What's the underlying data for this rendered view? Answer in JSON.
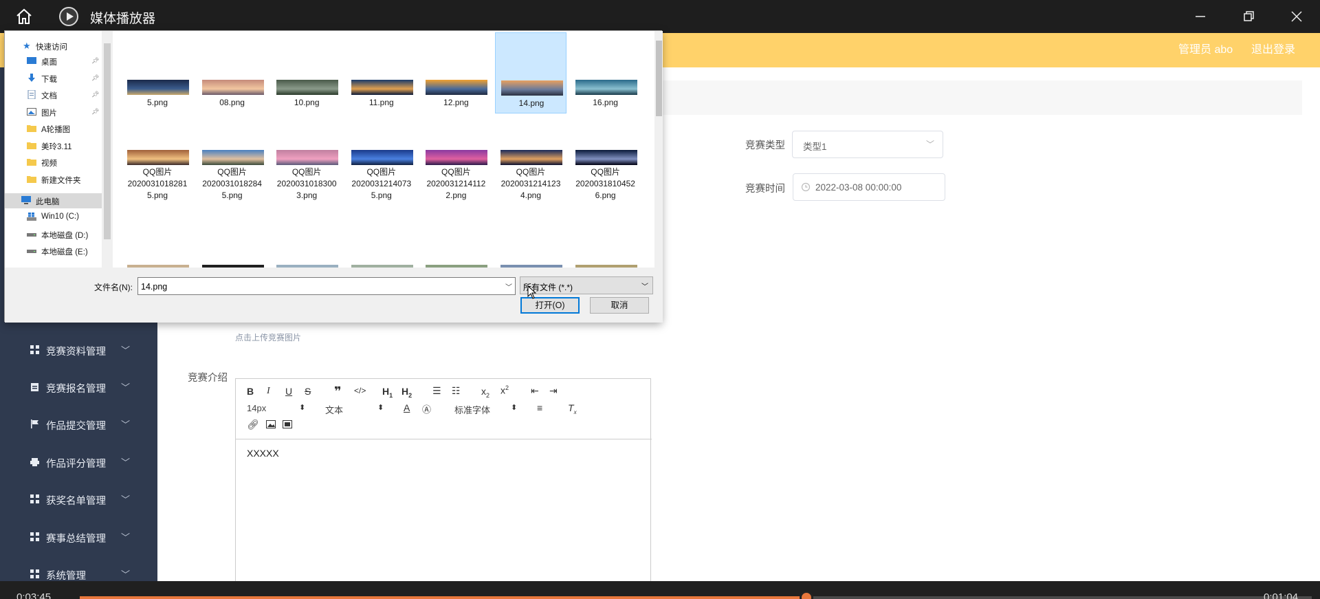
{
  "titlebar": {
    "title": "媒体播放器"
  },
  "header": {
    "admin": "管理员 abo",
    "logout": "退出登录"
  },
  "sidebar": {
    "items": [
      {
        "label": "竞赛资料管理",
        "icon": "grid-icon"
      },
      {
        "label": "竞赛报名管理",
        "icon": "clipboard-icon"
      },
      {
        "label": "作品提交管理",
        "icon": "flag-icon"
      },
      {
        "label": "作品评分管理",
        "icon": "printer-icon"
      },
      {
        "label": "获奖名单管理",
        "icon": "grid-icon"
      },
      {
        "label": "赛事总结管理",
        "icon": "grid-icon"
      },
      {
        "label": "系统管理",
        "icon": "grid-icon"
      }
    ]
  },
  "form": {
    "type_label": "竞赛类型",
    "type_value": "类型1",
    "time_label": "竞赛时间",
    "time_value": "2022-03-08 00:00:00",
    "upload_hint": "点击上传竞赛图片",
    "intro_label": "竞赛介绍",
    "editor": {
      "font_size": "14px",
      "text_style": "文本",
      "font_family": "标准字体",
      "content": "XXXXX"
    }
  },
  "player": {
    "elapsed": "0:03:45",
    "remaining": "0:01:04",
    "progress": 0.59
  },
  "dialog": {
    "nav": {
      "quick_access": "快速访问",
      "items": [
        {
          "label": "桌面",
          "icon": "desktop-icon",
          "pinned": true
        },
        {
          "label": "下载",
          "icon": "download-icon",
          "pinned": true
        },
        {
          "label": "文档",
          "icon": "document-icon",
          "pinned": true
        },
        {
          "label": "图片",
          "icon": "picture-icon",
          "pinned": true
        },
        {
          "label": "A轮播图",
          "icon": "folder-icon",
          "pinned": false
        },
        {
          "label": "美玲3.11",
          "icon": "folder-icon",
          "pinned": false
        },
        {
          "label": "视频",
          "icon": "folder-icon",
          "pinned": false
        },
        {
          "label": "新建文件夹",
          "icon": "folder-icon",
          "pinned": false
        }
      ],
      "this_pc": "此电脑",
      "drives": [
        {
          "label": "Win10 (C:)",
          "icon": "windows-drive-icon"
        },
        {
          "label": "本地磁盘 (D:)",
          "icon": "drive-icon"
        },
        {
          "label": "本地磁盘 (E:)",
          "icon": "drive-icon"
        }
      ]
    },
    "files": [
      {
        "lines": [
          "5.png"
        ],
        "colors": [
          "#1b2a4a",
          "#3b5c8c",
          "#c9a86a"
        ]
      },
      {
        "lines": [
          "08.png"
        ],
        "colors": [
          "#c58a7a",
          "#f2c6a0",
          "#6a5a6a"
        ]
      },
      {
        "lines": [
          "10.png"
        ],
        "colors": [
          "#4a5a4a",
          "#8a9a8a",
          "#2a3a2a"
        ]
      },
      {
        "lines": [
          "11.png"
        ],
        "colors": [
          "#1a3a6a",
          "#e0a050",
          "#0a1a3a"
        ]
      },
      {
        "lines": [
          "12.png"
        ],
        "colors": [
          "#f0a030",
          "#4a6a9a",
          "#202a40"
        ]
      },
      {
        "lines": [
          "14.png"
        ],
        "colors": [
          "#e8a060",
          "#6a7a9a",
          "#2a3040"
        ]
      },
      {
        "lines": [
          "16.png"
        ],
        "colors": [
          "#2a6a8a",
          "#8ac0d0",
          "#1a3a4a"
        ]
      },
      {
        "lines": [
          "QQ图片",
          "2020031018281",
          "5.png"
        ],
        "colors": [
          "#a0603a",
          "#f0c080",
          "#3a2a2a"
        ]
      },
      {
        "lines": [
          "QQ图片",
          "2020031018284",
          "5.png"
        ],
        "colors": [
          "#4a80c0",
          "#e0c0a0",
          "#3a4a3a"
        ]
      },
      {
        "lines": [
          "QQ图片",
          "2020031018300",
          "3.png"
        ],
        "colors": [
          "#c080a0",
          "#f0a0c0",
          "#5a5a7a"
        ]
      },
      {
        "lines": [
          "QQ图片",
          "2020031214073",
          "5.png"
        ],
        "colors": [
          "#1a3a8a",
          "#4a80e0",
          "#102040"
        ]
      },
      {
        "lines": [
          "QQ图片",
          "2020031214112",
          "2.png"
        ],
        "colors": [
          "#8a3aa0",
          "#e060a0",
          "#2a1a4a"
        ]
      },
      {
        "lines": [
          "QQ图片",
          "2020031214123",
          "4.png"
        ],
        "colors": [
          "#1a2a5a",
          "#e0a060",
          "#0a1030"
        ]
      },
      {
        "lines": [
          "QQ图片",
          "2020031810452",
          "6.png"
        ],
        "colors": [
          "#0a1a3a",
          "#8090c0",
          "#000010"
        ]
      }
    ],
    "selected_index": 5,
    "filename_label": "文件名(N):",
    "filename_value": "14.png",
    "filetype": "所有文件 (*.*)",
    "open_button": "打开(O)",
    "cancel_button": "取消"
  }
}
